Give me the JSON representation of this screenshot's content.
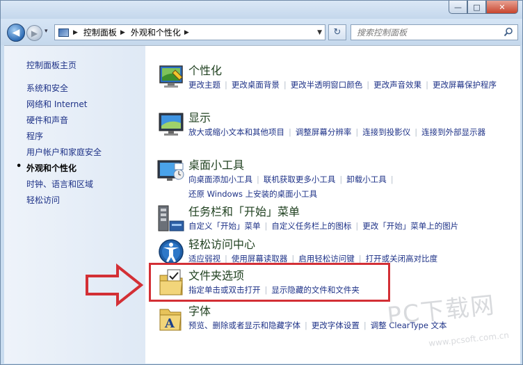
{
  "titlebar": {
    "minimize": "—",
    "maximize": "□",
    "close": "✕"
  },
  "nav": {
    "back": "◀",
    "forward": "▶",
    "history": "▾",
    "refresh": "↻"
  },
  "address": {
    "crumbs": [
      "控制面板",
      "外观和个性化"
    ]
  },
  "search": {
    "placeholder": "搜索控制面板"
  },
  "left": {
    "home": "控制面板主页",
    "items": [
      {
        "label": "系统和安全"
      },
      {
        "label": "网络和 Internet"
      },
      {
        "label": "硬件和声音"
      },
      {
        "label": "程序"
      },
      {
        "label": "用户帐户和家庭安全"
      },
      {
        "label": "外观和个性化",
        "current": true
      },
      {
        "label": "时钟、语言和区域"
      },
      {
        "label": "轻松访问"
      }
    ]
  },
  "categories": [
    {
      "title": "个性化",
      "icon": "personalization-icon",
      "links": [
        "更改主题",
        "更改桌面背景",
        "更改半透明窗口颜色",
        "更改声音效果",
        "更改屏幕保护程序"
      ]
    },
    {
      "title": "显示",
      "icon": "display-icon",
      "links": [
        "放大或缩小文本和其他项目",
        "调整屏幕分辨率",
        "连接到投影仪",
        "连接到外部显示器"
      ]
    },
    {
      "title": "桌面小工具",
      "icon": "gadgets-icon",
      "links": [
        "向桌面添加小工具",
        "联机获取更多小工具",
        "卸载小工具",
        "还原 Windows 上安装的桌面小工具"
      ]
    },
    {
      "title": "任务栏和「开始」菜单",
      "icon": "taskbar-icon",
      "links": [
        "自定义「开始」菜单",
        "自定义任务栏上的图标",
        "更改「开始」菜单上的图片"
      ]
    },
    {
      "title": "轻松访问中心",
      "icon": "ease-of-access-icon",
      "links": [
        "适应弱视",
        "使用屏幕读取器",
        "启用轻松访问键",
        "打开或关闭高对比度"
      ]
    },
    {
      "title": "文件夹选项",
      "icon": "folder-options-icon",
      "links": [
        "指定单击或双击打开",
        "显示隐藏的文件和文件夹"
      ]
    },
    {
      "title": "字体",
      "icon": "fonts-icon",
      "links": [
        "预览、删除或者显示和隐藏字体",
        "更改字体设置",
        "调整 ClearType 文本"
      ]
    }
  ],
  "watermark": {
    "brand": "PC下载网",
    "url": "www.pcsoft.com.cn"
  },
  "colors": {
    "link": "#1e3287",
    "highlight": "#d32f35",
    "arrow": "#d32f35"
  }
}
